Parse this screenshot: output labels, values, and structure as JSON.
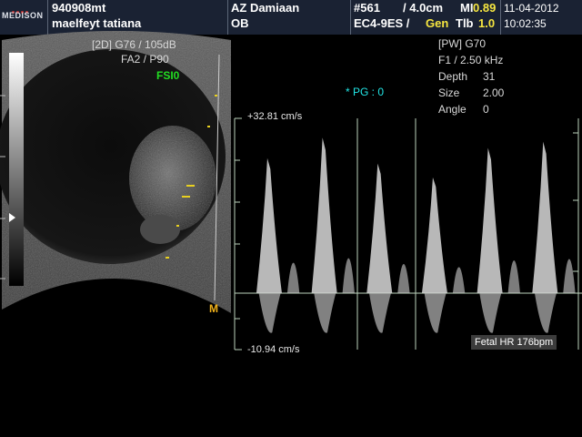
{
  "header": {
    "brand": "MEDISON",
    "patient_id": "940908mt",
    "patient_name": "maelfeyt tatiana",
    "hospital": "AZ Damiaan",
    "exam": "OB",
    "frame_no": "#561",
    "depth_label": "/ 4.0cm",
    "mi_label": "MI",
    "mi_value": "0.89",
    "probe": "EC4-9ES /",
    "preset_label": "Gen",
    "tib_label": "Tlb",
    "tib_value": "1.0",
    "date": "11-04-2012",
    "time": "10:02:35",
    "colors": {
      "bar": "#1a2233",
      "value": "#f6e640"
    }
  },
  "bmode": {
    "gain": "[2D] G76 / 105dB",
    "params": "FA2 / P90",
    "fsi": "FSI0",
    "m_marker": "M"
  },
  "doppler_params": {
    "mode": "[PW]  G70",
    "freq": "F1 / 2.50 kHz",
    "depth_label": "Depth",
    "depth_value": "31",
    "size_label": "Size",
    "size_value": "2.00",
    "angle_label": "Angle",
    "angle_value": "0"
  },
  "pg": "* PG : 0",
  "spectrum": {
    "top_velocity": "+32.81 cm/s",
    "bottom_velocity": "-10.94 cm/s",
    "fetal_hr": "Fetal HR 176bpm",
    "max_velocity": 32.81,
    "min_velocity": -10.94,
    "beats": 6
  }
}
